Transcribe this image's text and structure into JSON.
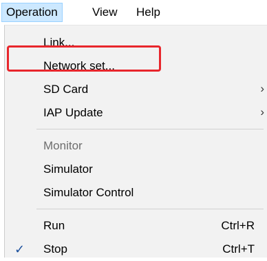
{
  "menubar": {
    "items": [
      {
        "label": "Operation"
      },
      {
        "label": "View"
      },
      {
        "label": "Help"
      }
    ]
  },
  "menu": {
    "items": [
      {
        "label": "Link..."
      },
      {
        "label": "Network set..."
      },
      {
        "label": "SD Card",
        "submenu": true
      },
      {
        "label": "IAP Update",
        "submenu": true
      },
      {
        "label": "Monitor",
        "disabled": true
      },
      {
        "label": "Simulator"
      },
      {
        "label": "Simulator Control"
      },
      {
        "label": "Run",
        "shortcut": "Ctrl+R"
      },
      {
        "label": "Stop",
        "shortcut": "Ctrl+T",
        "checked": true
      }
    ],
    "submenu_glyph": "›",
    "check_glyph": "✓"
  },
  "highlight": {
    "target": "Network set...",
    "color": "#e8262c"
  },
  "colors": {
    "menubar_active_bg": "#cce8ff",
    "menu_bg": "#f2f2f2",
    "disabled_text": "#6d6d6d"
  }
}
